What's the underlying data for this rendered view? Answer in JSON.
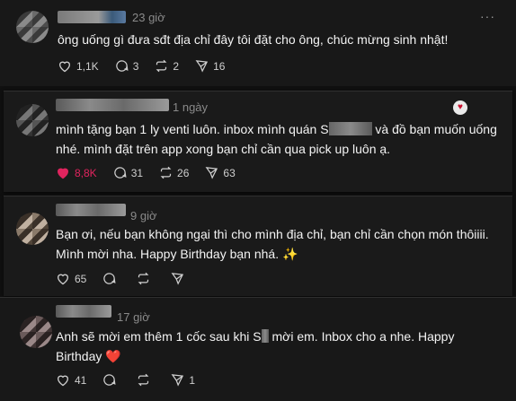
{
  "comments": [
    {
      "time": "23 giờ",
      "text": "ông uống gì đưa sđt địa chỉ đây tôi đặt cho ông, chúc mừng sinh nhật!",
      "likes": "1,1K",
      "replies": "3",
      "reposts": "2",
      "shares": "16",
      "liked": false
    },
    {
      "time": "1 ngày",
      "line1a": "mình tặng bạn 1 ly venti luôn. inbox mình quán S",
      "line1b": " và đồ bạn muốn uống",
      "line2": "nhé. mình đặt trên app xong bạn chỉ cần qua pick up luôn ạ.",
      "likes": "8,8K",
      "replies": "31",
      "reposts": "26",
      "shares": "63",
      "liked": true
    },
    {
      "time": "9 giờ",
      "line1": "Bạn ơi, nếu bạn không ngại thì cho mình địa chỉ, bạn chỉ cần chọn món thôiiii.",
      "line2": "Mình mời nha. Happy Birthday bạn nhá.",
      "sparkle": "✨",
      "likes": "65",
      "replies": "",
      "reposts": "",
      "shares": "",
      "liked": false
    },
    {
      "time": "17 giờ",
      "line1a": "Anh sẽ mời em thêm 1 cốc sau khi S",
      "line1b": " mời em. Inbox cho a nhe. Happy",
      "line2": "Birthday",
      "heart": "❤️",
      "likes": "41",
      "replies": "",
      "reposts": "",
      "shares": "1",
      "liked": false
    }
  ],
  "more_label": "···",
  "colors": {
    "like_red": "#e0245e",
    "muted": "#8a8a8a",
    "background": "#181818"
  }
}
